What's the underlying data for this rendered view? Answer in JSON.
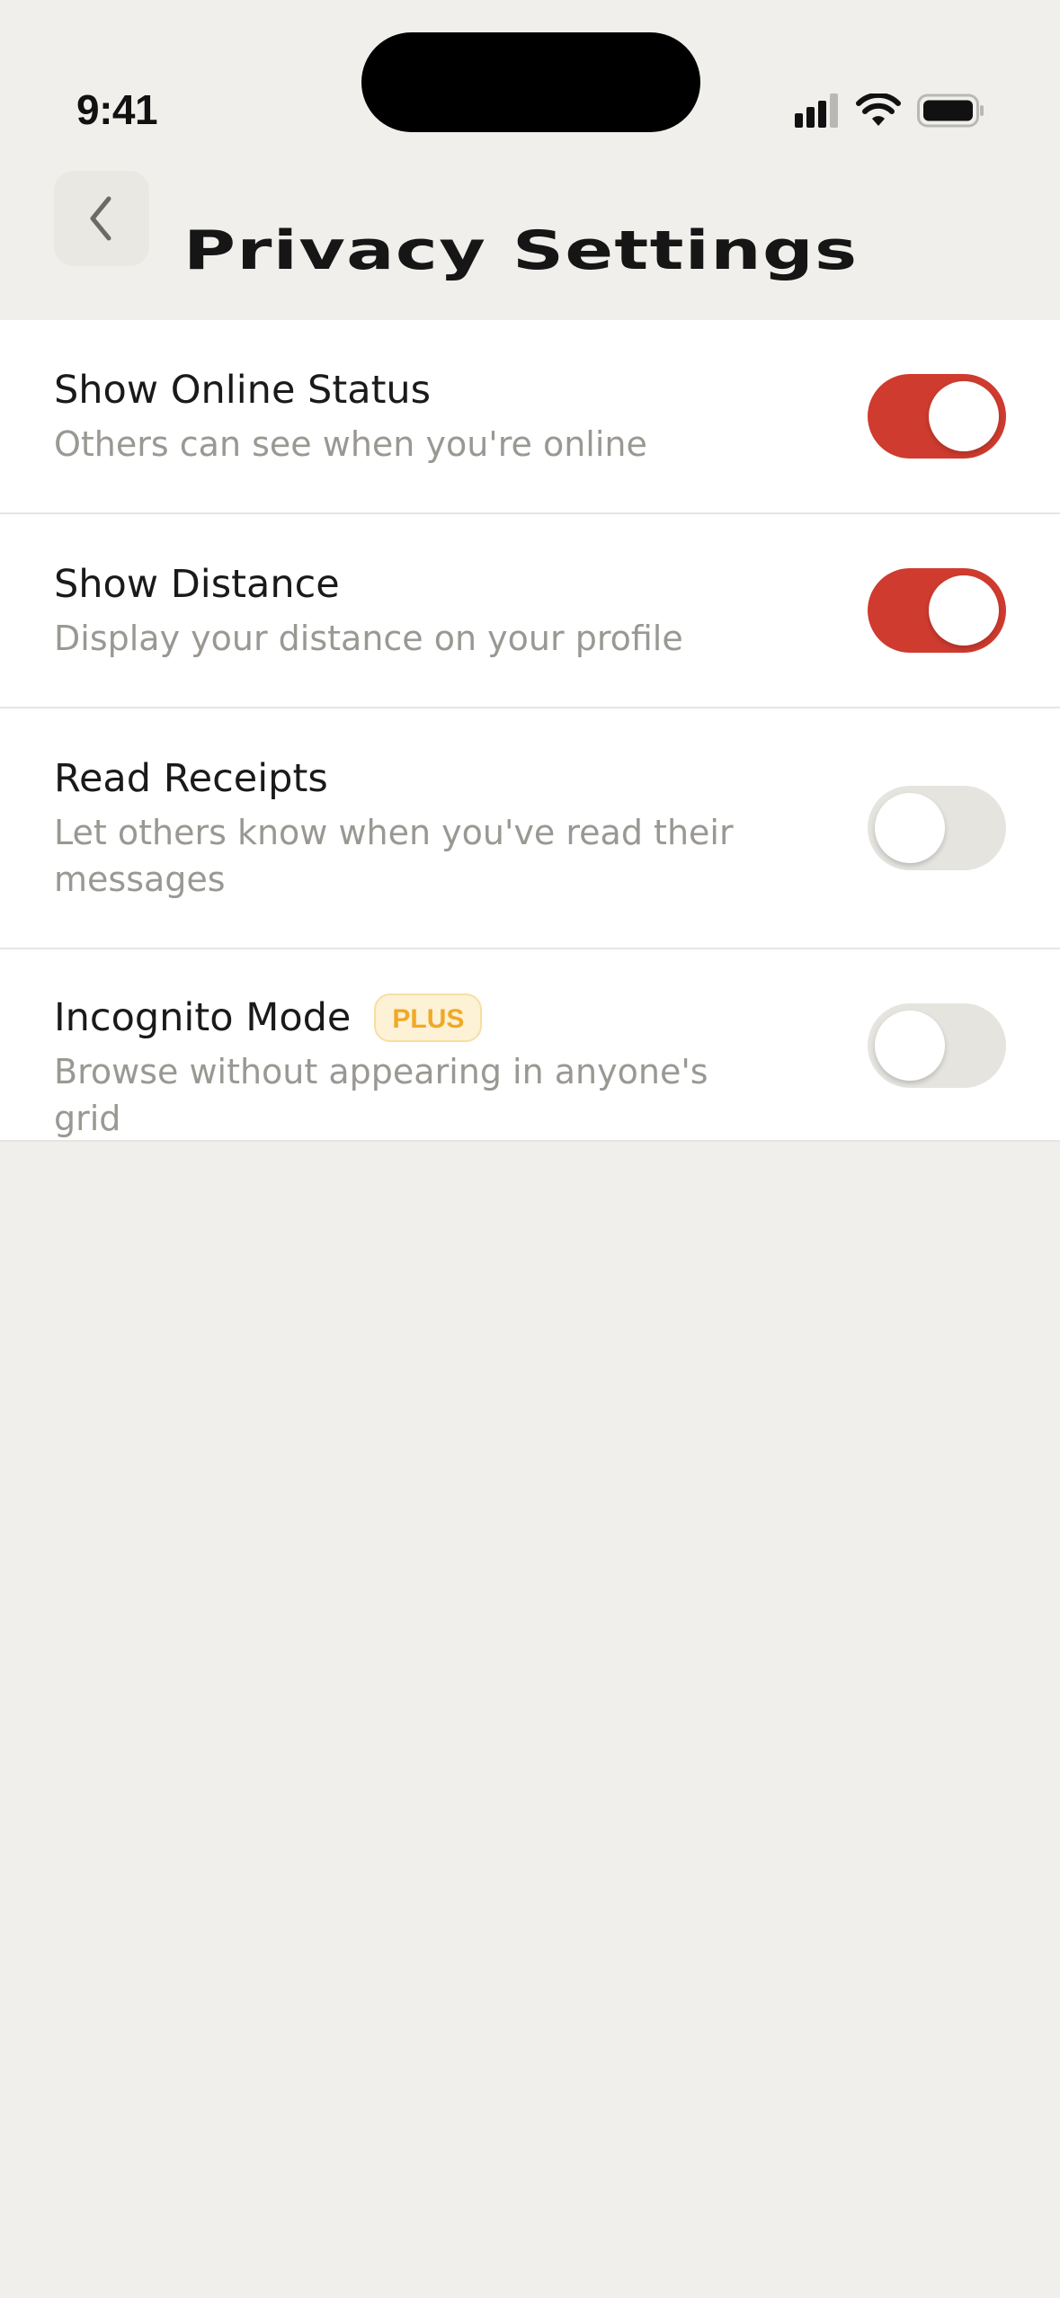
{
  "status_bar": {
    "time": "9:41"
  },
  "header": {
    "back_icon": "chevron-left-icon",
    "title": "Privacy Settings"
  },
  "settings": [
    {
      "title": "Show Online Status",
      "description": "Others can see when you're online",
      "enabled": true
    },
    {
      "title": "Show Distance",
      "description": "Display your distance on your profile",
      "enabled": true
    },
    {
      "title": "Read Receipts",
      "description": "Let others know when you've read their messages",
      "enabled": false
    },
    {
      "title": "Incognito Mode",
      "badge": "PLUS",
      "description": "Browse without appearing in anyone's grid",
      "enabled": false
    }
  ],
  "colors": {
    "accent": "#cf3b2f",
    "background": "#f0efeb",
    "badge_text": "#f0a925",
    "badge_bg": "#fdf1d6"
  }
}
